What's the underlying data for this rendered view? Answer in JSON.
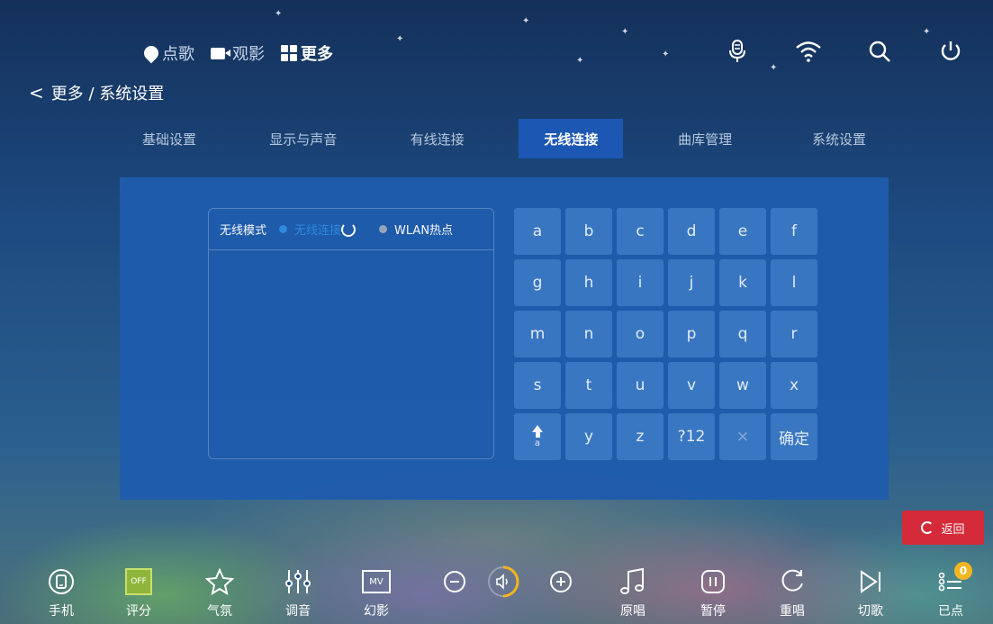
{
  "top_nav": {
    "items": [
      {
        "label": "点歌",
        "icon": "map-pin-icon"
      },
      {
        "label": "观影",
        "icon": "video-camera-icon"
      },
      {
        "label": "更多",
        "icon": "grid-icon",
        "active": true
      }
    ]
  },
  "top_right_icons": [
    "microphone-icon",
    "wifi-icon",
    "search-icon",
    "power-icon"
  ],
  "breadcrumb": "更多 / 系统设置",
  "tabs": [
    {
      "label": "基础设置"
    },
    {
      "label": "显示与声音"
    },
    {
      "label": "有线连接"
    },
    {
      "label": "无线连接",
      "active": true
    },
    {
      "label": "曲库管理"
    },
    {
      "label": "系统设置"
    }
  ],
  "wireless": {
    "mode_label": "无线模式",
    "option_wifi": "无线连接",
    "option_hotspot": "WLAN热点"
  },
  "keyboard": {
    "rows": [
      [
        "a",
        "b",
        "c",
        "d",
        "e",
        "f"
      ],
      [
        "g",
        "h",
        "i",
        "j",
        "k",
        "l"
      ],
      [
        "m",
        "n",
        "o",
        "p",
        "q",
        "r"
      ],
      [
        "s",
        "t",
        "u",
        "v",
        "w",
        "x"
      ],
      [
        "a",
        "y",
        "z",
        "?12",
        "×",
        "确定"
      ]
    ]
  },
  "return_label": "返回",
  "bottom_bar": {
    "items": [
      {
        "label": "手机",
        "icon": "phone-icon"
      },
      {
        "label": "评分",
        "icon": "score-off-icon",
        "icon_text": "OFF"
      },
      {
        "label": "气氛",
        "icon": "star-icon"
      },
      {
        "label": "调音",
        "icon": "equalizer-icon"
      },
      {
        "label": "幻影",
        "icon": "mv-icon",
        "icon_text": "MV"
      },
      {
        "label": "原唱",
        "icon": "music-note-icon"
      },
      {
        "label": "暂停",
        "icon": "pause-icon"
      },
      {
        "label": "重唱",
        "icon": "replay-icon"
      },
      {
        "label": "切歌",
        "icon": "next-icon"
      },
      {
        "label": "已点",
        "icon": "playlist-icon",
        "badge": "0"
      }
    ],
    "volume_icons": [
      "volume-down-icon",
      "volume-icon",
      "volume-up-icon"
    ]
  },
  "colors": {
    "accent": "#1c57b3",
    "panel": "#1f5cad",
    "key": "#3a78c4",
    "return": "#d42a39",
    "badge": "#f2b620"
  }
}
